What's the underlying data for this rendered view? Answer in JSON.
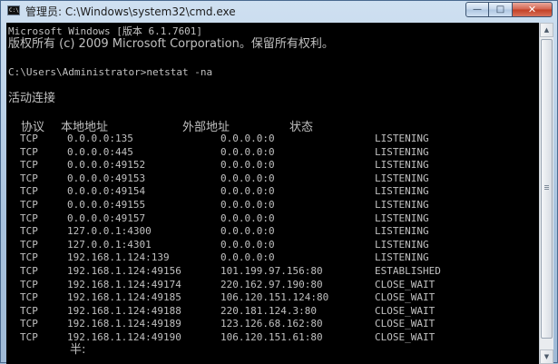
{
  "window": {
    "icon_text": "C:\\",
    "title": "管理员: C:\\Windows\\system32\\cmd.exe",
    "buttons": {
      "minimize": "—",
      "maximize": "□",
      "close": "✕"
    }
  },
  "console": {
    "lines": [
      "Microsoft Windows [版本 6.1.7601]",
      "版权所有 (c) 2009 Microsoft Corporation。保留所有权利。",
      "",
      "C:\\Users\\Administrator>netstat -na",
      "",
      "活动连接"
    ],
    "headers": {
      "proto": "协议",
      "local": "本地地址",
      "foreign": "外部地址",
      "state": "状态"
    },
    "connections": [
      {
        "proto": "TCP",
        "local": "0.0.0.0:135",
        "foreign": "0.0.0.0:0",
        "state": "LISTENING"
      },
      {
        "proto": "TCP",
        "local": "0.0.0.0:445",
        "foreign": "0.0.0.0:0",
        "state": "LISTENING"
      },
      {
        "proto": "TCP",
        "local": "0.0.0.0:49152",
        "foreign": "0.0.0.0:0",
        "state": "LISTENING"
      },
      {
        "proto": "TCP",
        "local": "0.0.0.0:49153",
        "foreign": "0.0.0.0:0",
        "state": "LISTENING"
      },
      {
        "proto": "TCP",
        "local": "0.0.0.0:49154",
        "foreign": "0.0.0.0:0",
        "state": "LISTENING"
      },
      {
        "proto": "TCP",
        "local": "0.0.0.0:49155",
        "foreign": "0.0.0.0:0",
        "state": "LISTENING"
      },
      {
        "proto": "TCP",
        "local": "0.0.0.0:49157",
        "foreign": "0.0.0.0:0",
        "state": "LISTENING"
      },
      {
        "proto": "TCP",
        "local": "127.0.0.1:4300",
        "foreign": "0.0.0.0:0",
        "state": "LISTENING"
      },
      {
        "proto": "TCP",
        "local": "127.0.0.1:4301",
        "foreign": "0.0.0.0:0",
        "state": "LISTENING"
      },
      {
        "proto": "TCP",
        "local": "192.168.1.124:139",
        "foreign": "0.0.0.0:0",
        "state": "LISTENING"
      },
      {
        "proto": "TCP",
        "local": "192.168.1.124:49156",
        "foreign": "101.199.97.156:80",
        "state": "ESTABLISHED"
      },
      {
        "proto": "TCP",
        "local": "192.168.1.124:49174",
        "foreign": "220.162.97.190:80",
        "state": "CLOSE_WAIT"
      },
      {
        "proto": "TCP",
        "local": "192.168.1.124:49185",
        "foreign": "106.120.151.124:80",
        "state": "CLOSE_WAIT"
      },
      {
        "proto": "TCP",
        "local": "192.168.1.124:49188",
        "foreign": "220.181.124.3:80",
        "state": "CLOSE_WAIT"
      },
      {
        "proto": "TCP",
        "local": "192.168.1.124:49189",
        "foreign": "123.126.68.162:80",
        "state": "CLOSE_WAIT"
      },
      {
        "proto": "TCP",
        "local": "192.168.1.124:49190",
        "foreign": "106.120.151.61:80",
        "state": "CLOSE_WAIT"
      }
    ],
    "ime_fragment": "半:"
  },
  "scrollbar": {
    "up_icon": "up-arrow-icon",
    "down_icon": "down-arrow-icon"
  },
  "colors": {
    "console_bg": "#000000",
    "console_text": "#c0c0c0",
    "title_glass": "#a9c3de"
  }
}
